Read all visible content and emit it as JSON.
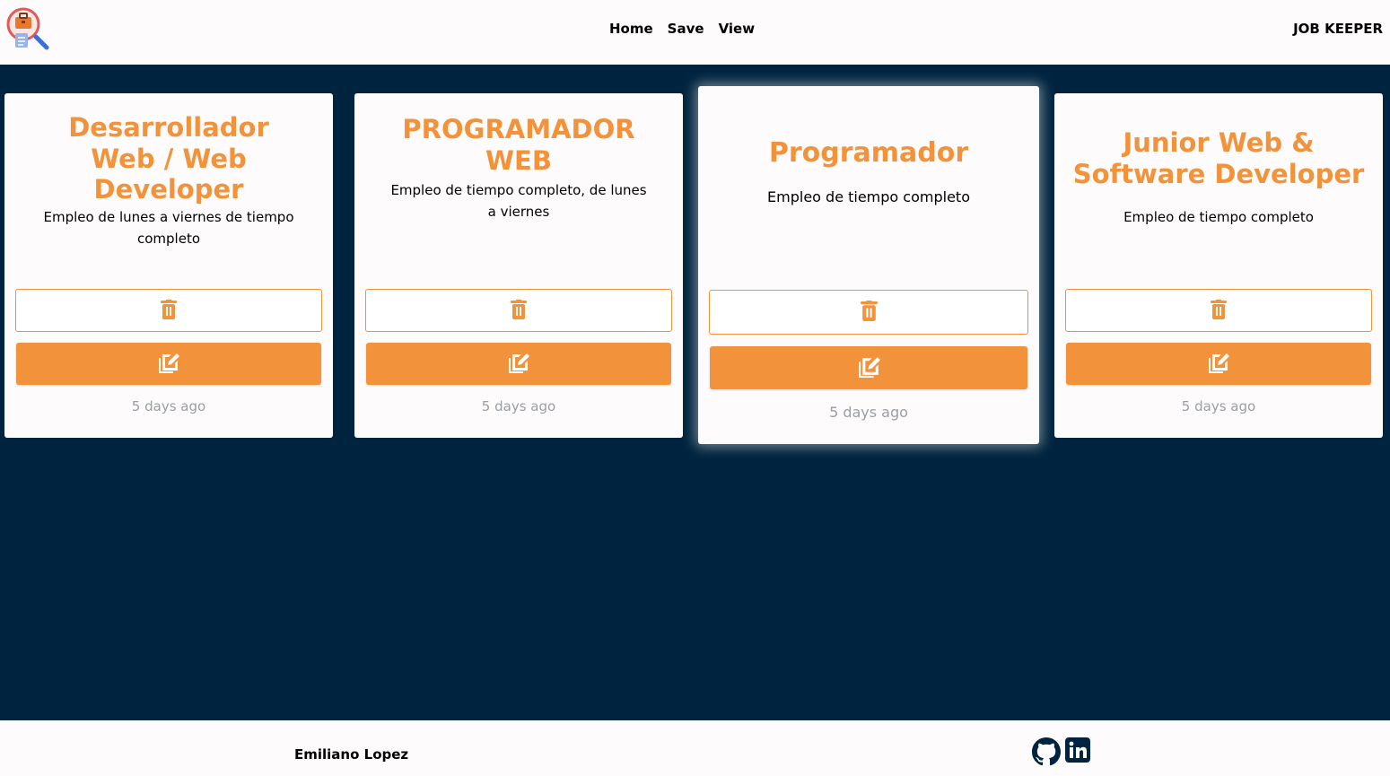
{
  "navbar": {
    "links": [
      "Home",
      "Save",
      "View"
    ],
    "brand": "JOB KEEPER"
  },
  "cards": [
    {
      "title": "Desarrollador Web / Web Developer",
      "description": "Empleo de lunes a viernes de tiempo completo",
      "posted": "5 days ago"
    },
    {
      "title": "PROGRAMADOR WEB",
      "description": "Empleo de tiempo completo, de lunes a viernes",
      "posted": "5 days ago"
    },
    {
      "title": "Programador",
      "description": "Empleo de tiempo completo",
      "posted": "5 days ago"
    },
    {
      "title": "Junior Web & Software Developer",
      "description": "Empleo de tiempo completo",
      "posted": "5 days ago"
    }
  ],
  "footer": {
    "author": "Emiliano Lopez"
  },
  "icons": [
    "job-search-logo-icon",
    "trash-icon",
    "edit-icon",
    "github-icon",
    "linkedin-icon"
  ],
  "colors": {
    "accent": "#f2933b",
    "background": "#00243f",
    "surface": "#fdfbfc",
    "muted": "#9a9ea6"
  }
}
